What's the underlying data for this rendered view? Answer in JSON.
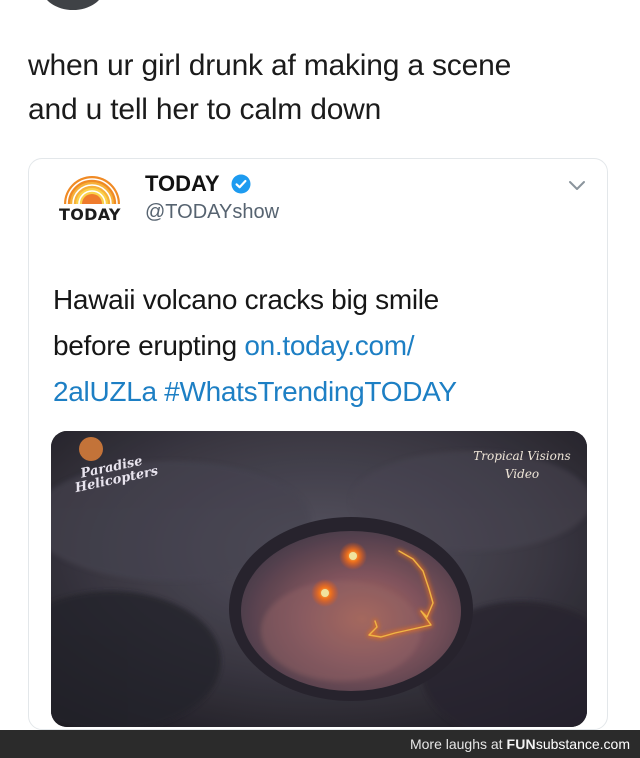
{
  "post": {
    "caption_line1": "when ur girl drunk af making a scene",
    "caption_line2": "and u tell her to calm down"
  },
  "tweet": {
    "logo_word": "TODAY",
    "display_name": "TODAY",
    "handle": "@TODAYshow",
    "text_part1": "Hawaii volcano cracks big smile",
    "text_part2": "before erupting ",
    "link_part1": "on.today.com/",
    "link_part2": "2alUZLa",
    "hashtag": "#WhatsTrendingTODAY",
    "image": {
      "watermark_left_line1": "Paradise",
      "watermark_left_line2": "Helicopters",
      "watermark_right_line1": "Tropical Visions",
      "watermark_right_line2": "Video"
    }
  },
  "footer": {
    "prefix": "More laughs at ",
    "brand_part1": "FUN",
    "brand_part2": "substance",
    "brand_part3": ".com"
  },
  "colors": {
    "link": "#1d7fc4",
    "verified": "#1d9bf0",
    "lava": "#ff6a1a",
    "footer_bg": "#2b2b2b"
  },
  "icons": [
    "verified-icon",
    "chevron-down-icon",
    "today-rainbow-logo"
  ]
}
